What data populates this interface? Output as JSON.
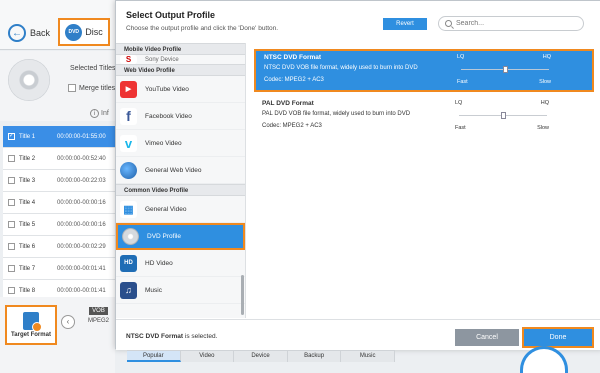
{
  "background": {
    "back_label": "Back",
    "disc_label": "Disc",
    "dvd_icon_text": "DVD",
    "selected_titles": "Selected Titles",
    "merge_titles": "Merge titles",
    "info_label": "Inf",
    "titles": [
      {
        "name": "Title 1",
        "duration": "00:00:00-01:55:00",
        "checked": true
      },
      {
        "name": "Title 2",
        "duration": "00:00:00-00:52:40",
        "checked": false
      },
      {
        "name": "Title 3",
        "duration": "00:00:00-00:22:03",
        "checked": false
      },
      {
        "name": "Title 4",
        "duration": "00:00:00-00:00:16",
        "checked": false
      },
      {
        "name": "Title 5",
        "duration": "00:00:00-00:00:16",
        "checked": false
      },
      {
        "name": "Title 6",
        "duration": "00:00:00-00:02:29",
        "checked": false
      },
      {
        "name": "Title 7",
        "duration": "00:00:00-00:01:41",
        "checked": false
      },
      {
        "name": "Title 8",
        "duration": "00:00:00-00:01:41",
        "checked": false
      }
    ],
    "target_format_label": "Target Format",
    "vob_tag": "VOB",
    "vob_codec": "MPEG2"
  },
  "dialog": {
    "title": "Select Output Profile",
    "subtitle": "Choose the output profile and click the 'Done' button.",
    "revert_label": "Revert",
    "search_placeholder": "Search...",
    "categories": {
      "mobile_header": "Mobile Video Profile",
      "sony_partial": "Sony Device",
      "web_header": "Web Video Profile",
      "web_items": [
        "YouTube Video",
        "Facebook Video",
        "Vimeo Video",
        "General Web Video"
      ],
      "common_header": "Common Video Profile",
      "common_items": [
        "General Video",
        "DVD Profile",
        "HD Video",
        "Music"
      ],
      "active_item": "DVD Profile"
    },
    "profiles": [
      {
        "name": "NTSC DVD Format",
        "description": "NTSC DVD VOB file format, widely used to burn into DVD",
        "codec": "Codec: MPEG2 + AC3",
        "lq": "LQ",
        "hq": "HQ",
        "fast": "Fast",
        "slow": "Slow",
        "quality_level": 0.5,
        "selected": true
      },
      {
        "name": "PAL DVD Format",
        "description": "PAL DVD VOB file format, widely used to burn into DVD",
        "codec": "Codec: MPEG2 + AC3",
        "lq": "LQ",
        "hq": "HQ",
        "fast": "Fast",
        "slow": "Slow",
        "quality_level": 0.5,
        "selected": false
      }
    ],
    "status_name": "NTSC DVD Format",
    "status_suffix": " is selected.",
    "cancel_label": "Cancel",
    "done_label": "Done"
  },
  "tabs": [
    "Popular",
    "Video",
    "Device",
    "Backup",
    "Music"
  ],
  "active_tab": "Popular",
  "colors": {
    "accent": "#2f8fe0",
    "highlight": "#f0891f",
    "selected_row": "#3a8ee6"
  }
}
